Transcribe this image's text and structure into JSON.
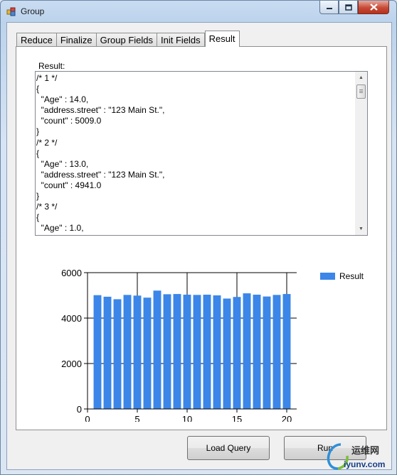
{
  "window": {
    "title": "Group"
  },
  "tabs": [
    "Reduce",
    "Finalize",
    "Group Fields",
    "Init Fields",
    "Result"
  ],
  "active_tab": "Result",
  "result": {
    "label": "Result:",
    "text": "/* 1 */\n{\n  \"Age\" : 14.0,\n  \"address.street\" : \"123 Main St.\",\n  \"count\" : 5009.0\n}\n/* 2 */\n{\n  \"Age\" : 13.0,\n  \"address.street\" : \"123 Main St.\",\n  \"count\" : 4941.0\n}\n/* 3 */\n{\n  \"Age\" : 1.0,"
  },
  "chart_data": {
    "type": "bar",
    "x": [
      1,
      2,
      3,
      4,
      5,
      6,
      7,
      8,
      9,
      10,
      11,
      12,
      13,
      14,
      15,
      16,
      17,
      18,
      19,
      20
    ],
    "series": [
      {
        "name": "Result",
        "values": [
          5009,
          4941,
          4830,
          5020,
          4990,
          4900,
          5210,
          5050,
          5060,
          5030,
          5020,
          5030,
          5000,
          4860,
          4930,
          5090,
          5030,
          4950,
          5020,
          5060
        ],
        "color": "#3b86e8"
      }
    ],
    "xticks": [
      "0",
      "5",
      "10",
      "15",
      "20"
    ],
    "yticks": [
      "0",
      "2000",
      "4000",
      "6000"
    ],
    "xlim": [
      0,
      21
    ],
    "ylim": [
      0,
      6000
    ],
    "grid": true,
    "legend": "top-right"
  },
  "buttons": {
    "load_query": "Load Query",
    "run": "Run"
  },
  "watermark": {
    "cn": "运维网",
    "url": "iyunv.com"
  },
  "colors": {
    "bar": "#3b86e8",
    "window_bg": "#f0f0f0"
  }
}
